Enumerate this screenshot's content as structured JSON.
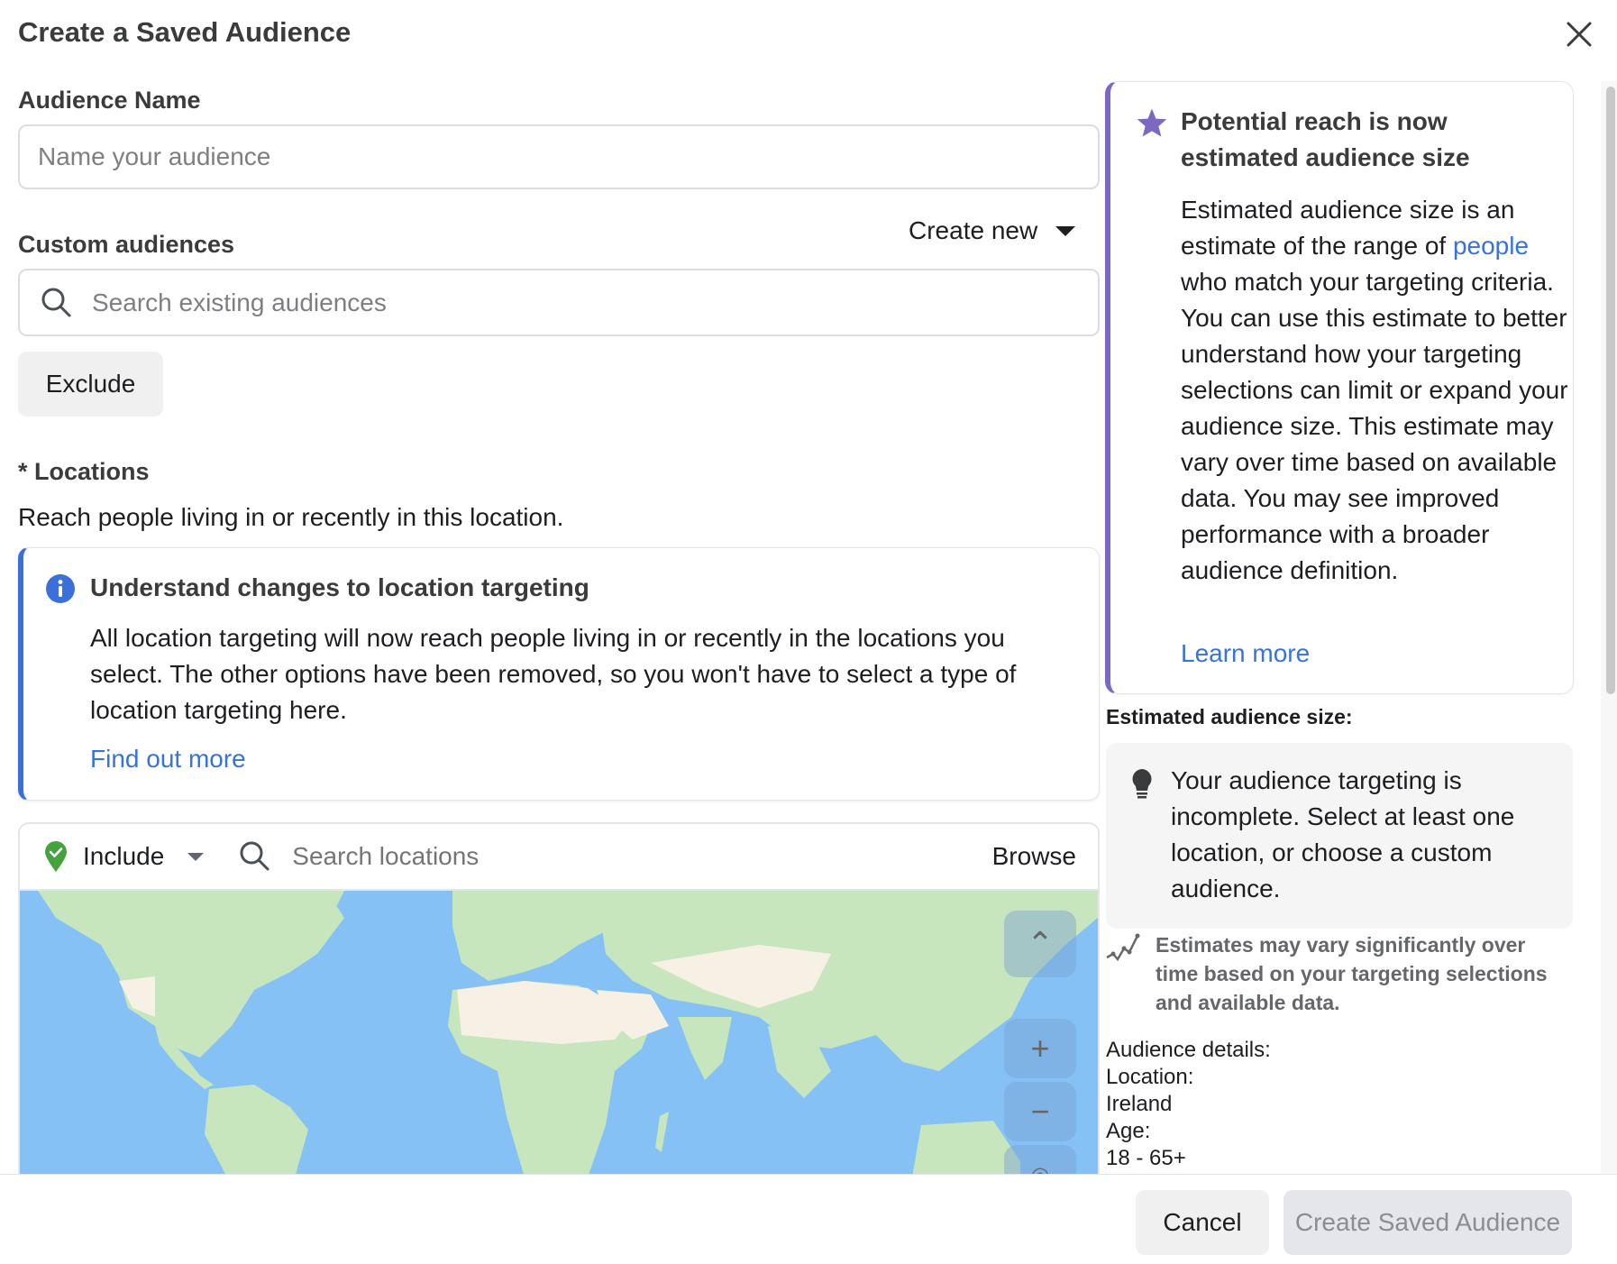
{
  "dialog": {
    "title": "Create a Saved Audience",
    "close_icon": "close-icon"
  },
  "audience_name": {
    "label": "Audience Name",
    "placeholder": "Name your audience",
    "value": ""
  },
  "custom_audiences": {
    "label": "Custom audiences",
    "create_new_label": "Create new",
    "search_placeholder": "Search existing audiences",
    "exclude_label": "Exclude"
  },
  "locations": {
    "label": "* Locations",
    "subtitle": "Reach people living in or recently in this location.",
    "callout": {
      "icon": "info-icon",
      "title": "Understand changes to location targeting",
      "body": "All location targeting will now reach people living in or recently in the locations you select. The other options have been removed, so you won't have to select a type of location targeting here.",
      "link": "Find out more"
    },
    "include_label": "Include",
    "search_placeholder": "Search locations",
    "browse_label": "Browse",
    "map_controls": [
      "collapse",
      "zoom-in",
      "zoom-out",
      "recenter"
    ]
  },
  "reach_card": {
    "icon": "star-icon",
    "title": "Potential reach is now estimated audience size",
    "body_before_link": "Estimated audience size is an estimate of the range of ",
    "body_link": "people",
    "body_after_link": " who match your targeting criteria. You can use this estimate to better understand how your targeting selections can limit or expand your audience size. This estimate may vary over time based on available data. You may see improved performance with a broader audience definition.",
    "learn_more": "Learn more"
  },
  "estimate": {
    "label": "Estimated audience size:",
    "incomplete_message": "Your audience targeting is incomplete. Select at least one location, or choose a custom audience.",
    "vary_note": "Estimates may vary significantly over time based on your targeting selections and available data."
  },
  "audience_details": {
    "heading": "Audience details:",
    "location_label": "Location:",
    "location_value": "Ireland",
    "age_label": "Age:",
    "age_value": "18 - 65+"
  },
  "footer": {
    "cancel_label": "Cancel",
    "create_label": "Create Saved Audience"
  },
  "colors": {
    "accent_blue": "#3873d8",
    "info_border": "#3b6fd9",
    "reach_border": "#7b68c2",
    "include_green": "#45a33f",
    "map_water": "#86c1f5",
    "map_land": "#c8e6bd",
    "map_desert": "#f6f1e4"
  }
}
